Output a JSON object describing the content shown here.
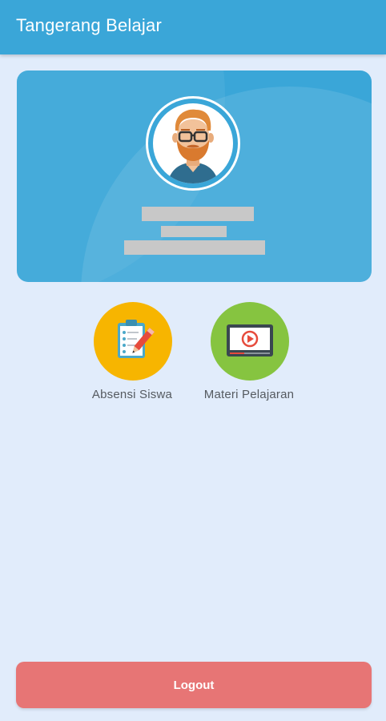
{
  "appbar": {
    "title": "Tangerang Belajar"
  },
  "profile": {
    "avatar_icon": "bearded-man-avatar",
    "card_color": "#3aa6d8"
  },
  "menu": [
    {
      "label": "Absensi Siswa",
      "icon": "clipboard-pencil-icon",
      "color": "#f7b500"
    },
    {
      "label": "Materi Pelajaran",
      "icon": "video-player-icon",
      "color": "#86c440"
    }
  ],
  "logout": {
    "label": "Logout",
    "color": "#e77575"
  }
}
